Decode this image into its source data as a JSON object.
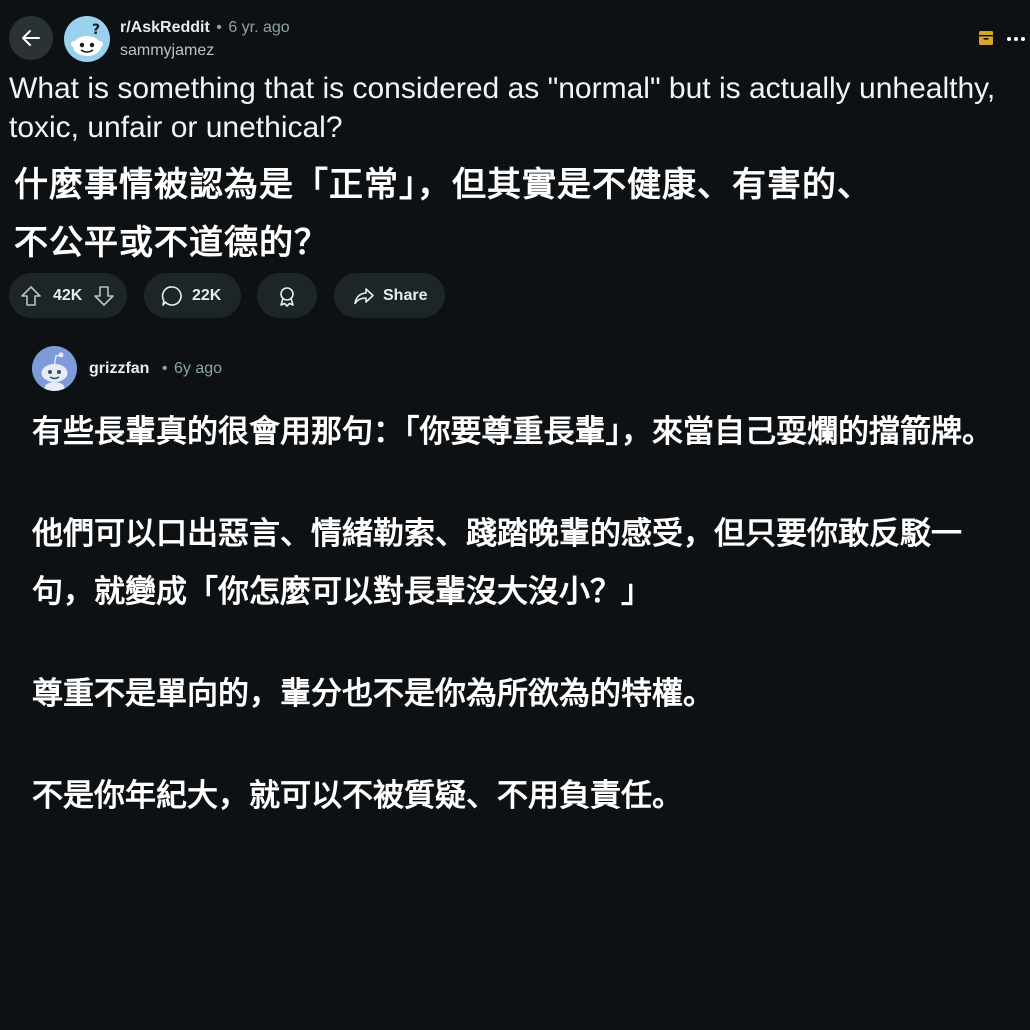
{
  "header": {
    "subreddit": "r/AskReddit",
    "separator": "•",
    "age": "6 yr. ago",
    "author": "sammyjamez"
  },
  "post": {
    "title_en": "What is something that is considered as \"normal\" but is actually unhealthy, toxic, unfair or unethical?",
    "title_zh_line1": "什麼事情被認為是「正常」，但其實是不健康、有害的、",
    "title_zh_line2": "不公平或不道德的？"
  },
  "actions": {
    "votes": "42K",
    "comments": "22K",
    "share_label": "Share"
  },
  "comment": {
    "username": "grizzfan",
    "separator": "•",
    "age": "6y ago",
    "paragraphs": [
      "有些長輩真的很會用那句：「你要尊重長輩」，來當自己耍爛的擋箭牌。",
      "他們可以口出惡言、情緒勒索、踐踏晚輩的感受，但只要你敢反駁一句，就變成「你怎麼可以對長輩沒大沒小？」",
      "尊重不是單向的，輩分也不是你為所欲為的特權。",
      "不是你年紀大，就可以不被質疑、不用負責任。"
    ]
  },
  "colors": {
    "background": "#0e1113",
    "pill": "#1e2529",
    "muted_text": "#8ba2ad",
    "archive_icon": "#d4a72c"
  },
  "icons": [
    "back-arrow-icon",
    "snoo-avatar-icon",
    "archive-icon",
    "more-icon",
    "upvote-icon",
    "downvote-icon",
    "comment-icon",
    "award-icon",
    "share-icon"
  ]
}
